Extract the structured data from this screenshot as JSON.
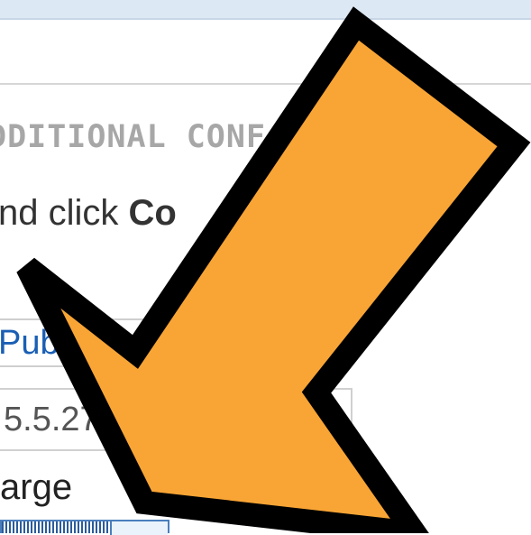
{
  "section": {
    "heading": "DDITIONAL CONF"
  },
  "instruction": {
    "prefix": "nd click ",
    "bold": "Co"
  },
  "fields": {
    "ip_type_value": "Pub",
    "version_value": "5.5.27",
    "size_value": "arge"
  },
  "overlay": {
    "arrow_fill": "#f9a535",
    "arrow_stroke": "#000000"
  }
}
